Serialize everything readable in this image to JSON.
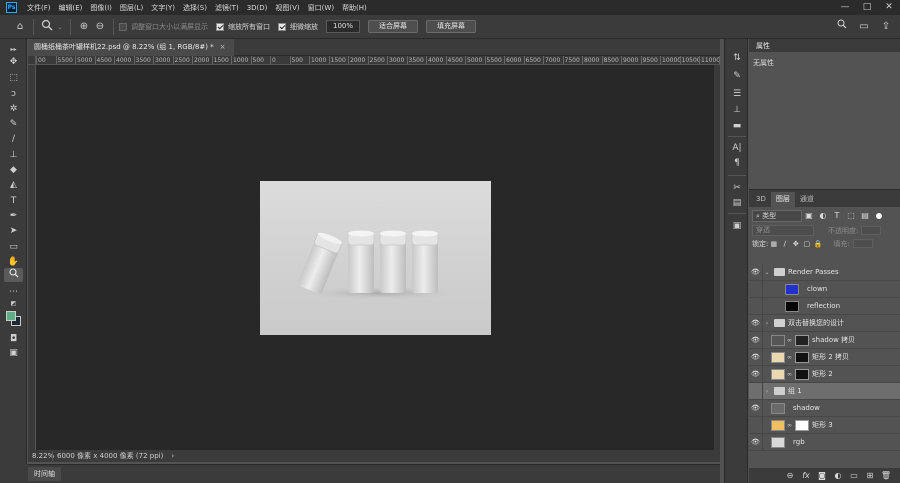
{
  "menubar": {
    "logo": "Ps",
    "items": [
      "文件(F)",
      "编辑(E)",
      "图像(I)",
      "图层(L)",
      "文字(Y)",
      "选择(S)",
      "滤镜(T)",
      "3D(D)",
      "视图(V)",
      "窗口(W)",
      "帮助(H)"
    ],
    "minimize": "—",
    "maximize": "□",
    "close": "✕"
  },
  "options": {
    "home_icon": "⌂",
    "zoom_icon": "🔍",
    "zoom_in": "⊕",
    "zoom_out": "⊖",
    "resize_windows_label": "调整窗口大小以满屏显示",
    "zoom_all_label": "缩放所有窗口",
    "scrubby_label": "细微缩放",
    "zoom_value": "100%",
    "fit_screen": "适合屏幕",
    "fill_screen": "填充屏幕",
    "right_search": "⌕",
    "right_workspace": "▭",
    "right_share": "⇪"
  },
  "document": {
    "tab_title": "圆桶纸桶茶叶罐样机22.psd @ 8.22% (组 1, RGB/8#) *",
    "close": "×"
  },
  "ruler": {
    "ticks": [
      "00",
      "5500",
      "5000",
      "4500",
      "4000",
      "3500",
      "3000",
      "2500",
      "2000",
      "1500",
      "1000",
      "500",
      "0",
      "500",
      "1000",
      "1500",
      "2000",
      "2500",
      "3000",
      "3500",
      "4000",
      "4500",
      "5000",
      "5500",
      "6000",
      "6500",
      "7000",
      "7500",
      "8000",
      "8500",
      "9000",
      "9500",
      "10000",
      "10500",
      "11000",
      "115"
    ]
  },
  "status": {
    "zoom": "8.22%",
    "dimensions": "6000 像素 x 4000 像素 (72 ppi)",
    "arrow": "›"
  },
  "timeline": {
    "label": "时间轴"
  },
  "properties": {
    "title": "属性",
    "empty_label": "无属性"
  },
  "layers": {
    "tabs": [
      "3D",
      "图层",
      "通道"
    ],
    "filter_kind": "类型",
    "blend_mode": "穿透",
    "opacity_label": "不透明度:",
    "fill_label": "填充:",
    "lock_label": "锁定:",
    "items": [
      {
        "name": "Render Passes",
        "visible": true,
        "type": "group",
        "expanded": true
      },
      {
        "name": "clown",
        "visible": false,
        "type": "layer",
        "thumb_color": "#2233cc"
      },
      {
        "name": "reflection",
        "visible": false,
        "type": "layer",
        "thumb_color": "#050505"
      },
      {
        "name": "双击替换您的设计",
        "visible": true,
        "type": "group",
        "expanded": false
      },
      {
        "name": "shadow 拷贝",
        "visible": true,
        "type": "smart"
      },
      {
        "name": "矩形 2 拷贝",
        "visible": true,
        "type": "shape"
      },
      {
        "name": "矩形 2",
        "visible": true,
        "type": "shape"
      },
      {
        "name": "组 1",
        "visible": false,
        "type": "group",
        "expanded": false,
        "selected": true
      },
      {
        "name": "shadow",
        "visible": true,
        "type": "layer",
        "thumb_color": "#6a6a6a"
      },
      {
        "name": "矩形 3",
        "visible": false,
        "type": "shape"
      },
      {
        "name": "rgb",
        "visible": true,
        "type": "layer",
        "thumb_color": "#d8d8d8"
      }
    ],
    "footer_icons": [
      "link-icon",
      "fx-icon",
      "mask-icon",
      "adjustment-icon",
      "folder-icon",
      "new-layer-icon",
      "trash-icon"
    ]
  },
  "colors": {
    "foreground": "#5cae84",
    "background": "#1e2a33",
    "canvas_bg": "#282828",
    "panel_bg": "#535353",
    "chrome_bg": "#3b3b3b"
  }
}
